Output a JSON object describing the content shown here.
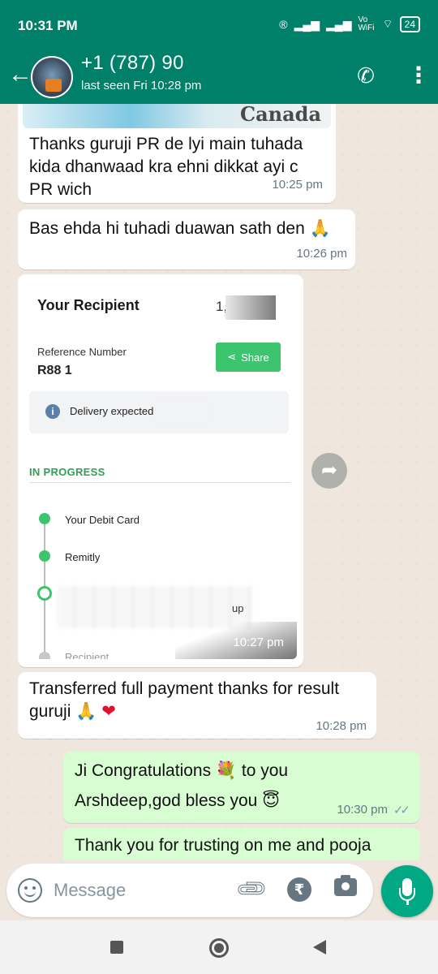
{
  "status_bar": {
    "time": "10:31 PM",
    "battery": "24",
    "network": "Vo WiFi"
  },
  "header": {
    "contact_name": "+1 (787) 90",
    "last_seen": "last seen Fri 10:28 pm"
  },
  "messages": [
    {
      "direction": "in",
      "image_label": "Canada"
    },
    {
      "direction": "in",
      "text": "Thanks guruji PR de lyi main tuhada kida dhanwaad kra ehni dikkat ayi c PR wich",
      "time": "10:25 pm"
    },
    {
      "direction": "in",
      "text": "Bas ehda hi tuhadi duawan sath den 🙏",
      "time": "10:26 pm"
    },
    {
      "direction": "in",
      "time": "10:27 pm",
      "receipt": {
        "title": "Your Recipient",
        "amount": "1,000",
        "reference_label": "Reference Number",
        "reference_value": "R88 1",
        "share_label": "Share",
        "delivery_text": "Delivery expected",
        "status": "IN PROGRESS",
        "timeline": [
          "Your Debit Card",
          "Remitly",
          "up",
          "Recipient"
        ]
      }
    },
    {
      "direction": "in",
      "text": "Transferred full payment thanks for result guruji 🙏",
      "heart": "❤",
      "time": "10:28 pm"
    },
    {
      "direction": "out",
      "text_a": "Ji Congratulations 💐 to you",
      "text_b": "Arshdeep,god bless you 😇",
      "time": "10:30 pm",
      "ticks": "✓✓"
    },
    {
      "direction": "out",
      "text": "Thank you for trusting on me and pooja"
    }
  ],
  "input": {
    "placeholder": "Message"
  },
  "icons": {
    "back": "arrow-left-icon",
    "call": "add-call-icon",
    "menu": "more-vertical-icon",
    "forward": "forward-icon",
    "emoji": "emoji-icon",
    "attach": "paperclip-icon",
    "payment": "rupee-icon",
    "camera": "camera-icon",
    "mic": "mic-icon"
  },
  "colors": {
    "header": "#008069",
    "outgoing_bubble": "#d9fdd3",
    "incoming_bubble": "#ffffff",
    "mic_button": "#00a884",
    "share_button": "#3cc56d"
  }
}
